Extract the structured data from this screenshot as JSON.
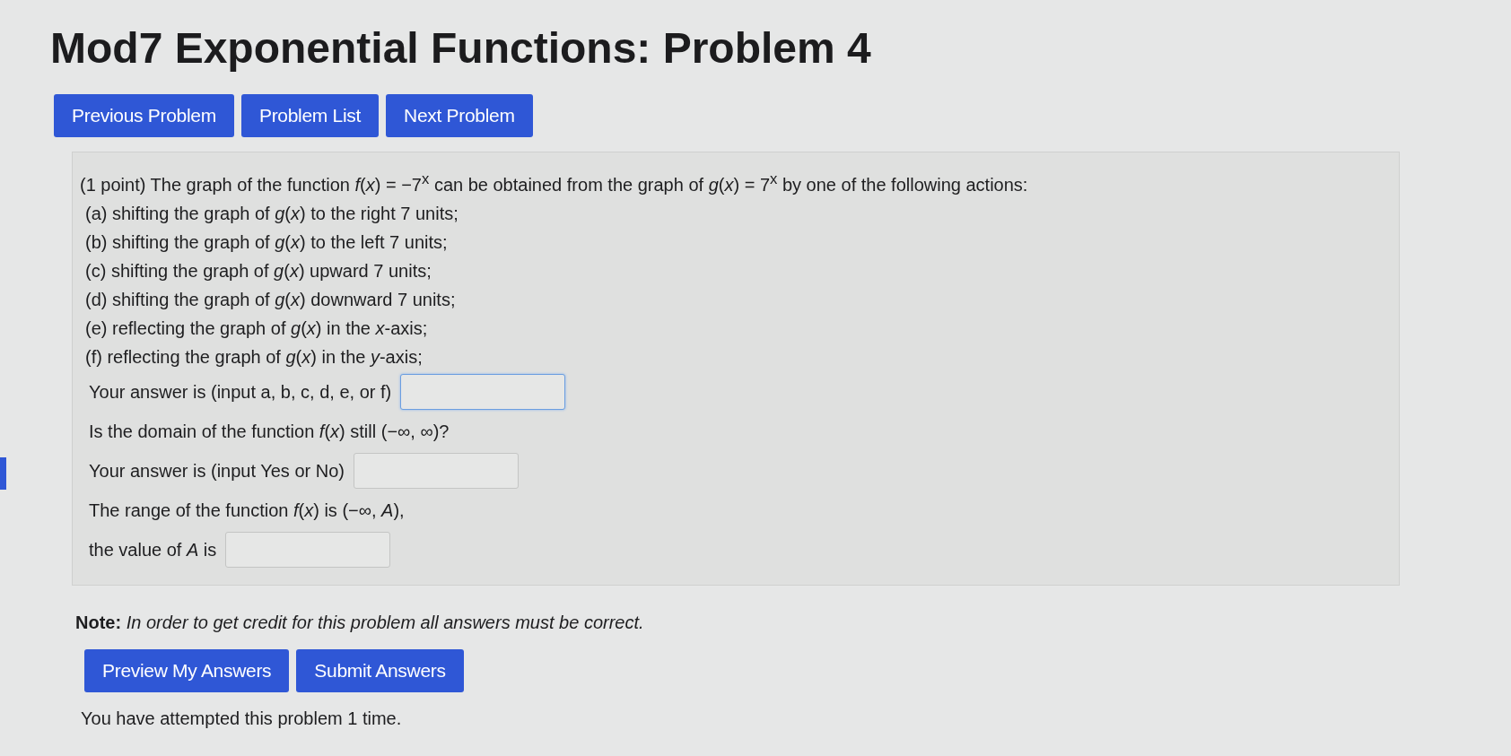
{
  "title": "Mod7 Exponential Functions: Problem 4",
  "nav_buttons": [
    "Previous Problem",
    "Problem List",
    "Next Problem"
  ],
  "problem": {
    "intro": "(1 point) The graph of the function *f*(*x*) = −7$^{x}$ can be obtained from the graph of *g*(*x*) = 7$^{x}$ by one of the following actions:",
    "options": [
      "(a) shifting the graph of *g*(*x*) to the right 7 units;",
      "(b) shifting the graph of *g*(*x*) to the left 7 units;",
      "(c) shifting the graph of *g*(*x*) upward 7 units;",
      "(d) shifting the graph of *g*(*x*) downward 7 units;",
      "(e) reflecting the graph of *g*(*x*) in the *x*-axis;",
      "(f) reflecting the graph of *g*(*x*) in the *y*-axis;"
    ],
    "rows": [
      {
        "kind": "input",
        "label": "Your answer is (input a, b, c, d, e, or f)",
        "focused": true
      },
      {
        "kind": "text",
        "label": "Is the domain of the function *f*(*x*) still (−∞, ∞)?"
      },
      {
        "kind": "input",
        "label": "Your answer is (input Yes or No)",
        "focused": false
      },
      {
        "kind": "text",
        "label": "The range of the function *f*(*x*) is (−∞, *A*),"
      },
      {
        "kind": "input",
        "label": "the value of *A* is",
        "focused": false
      }
    ]
  },
  "note": {
    "label": "Note:",
    "text": "In order to get credit for this problem all answers must be correct."
  },
  "action_buttons": [
    "Preview My Answers",
    "Submit Answers"
  ],
  "attempts": "You have attempted this problem 1 time."
}
